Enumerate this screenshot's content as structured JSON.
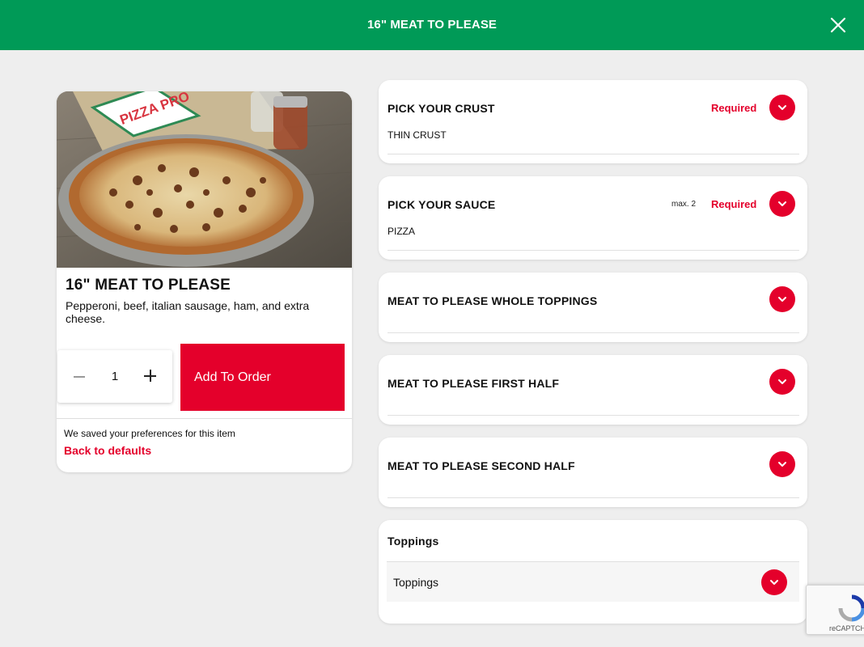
{
  "header": {
    "title": "16\" MEAT TO PLEASE",
    "background": "#009a57"
  },
  "item": {
    "image_logo_text": "PIZZA PRO",
    "name": "16\" MEAT TO PLEASE",
    "description": "Pepperoni, beef, italian sausage, ham, and extra cheese.",
    "quantity": "1",
    "add_button_label": "Add To Order",
    "saved_note": "We saved your preferences for this item",
    "back_link": "Back to defaults"
  },
  "sections": {
    "crust": {
      "heading": "PICK YOUR CRUST",
      "required": "Required",
      "selected": "THIN CRUST"
    },
    "sauce": {
      "heading": "PICK YOUR SAUCE",
      "max": "max. 2",
      "required": "Required",
      "selected": "PIZZA"
    },
    "whole": {
      "heading": "MEAT TO PLEASE WHOLE TOPPINGS"
    },
    "first": {
      "heading": "MEAT TO PLEASE FIRST HALF"
    },
    "second": {
      "heading": "MEAT TO PLEASE SECOND HALF"
    },
    "toppings": {
      "heading": "Toppings",
      "sub_label": "Toppings"
    }
  },
  "recaptcha": {
    "label": "reCAPTCHA"
  },
  "colors": {
    "accent_red": "#e4002b",
    "brand_green": "#009a57",
    "background": "#eeeeee"
  },
  "icons": [
    "close-icon",
    "minus-icon",
    "plus-icon",
    "chevron-down-icon",
    "recaptcha-icon"
  ]
}
